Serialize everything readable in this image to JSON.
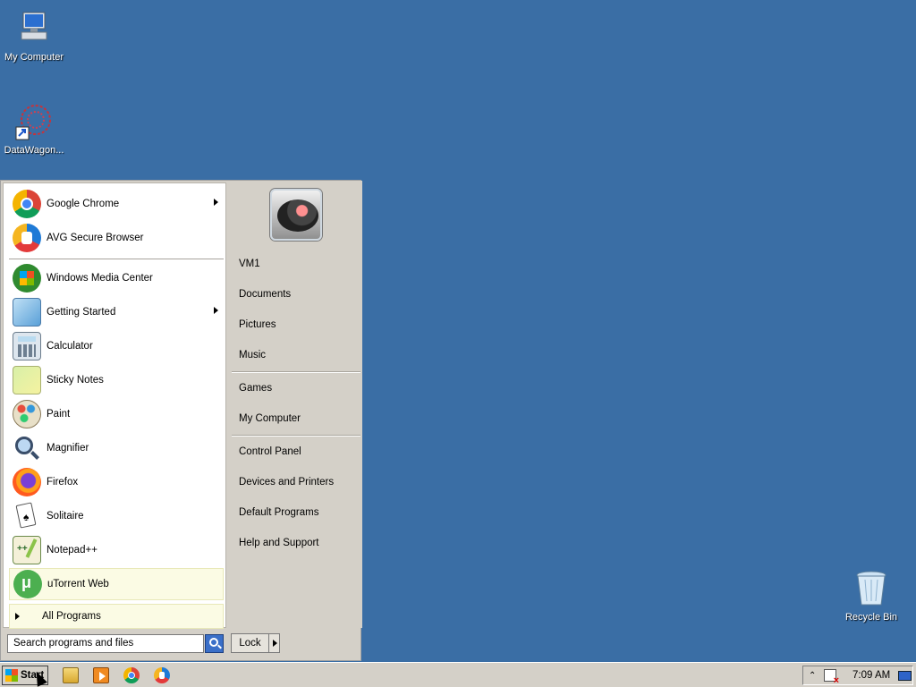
{
  "desktop": {
    "icons": [
      {
        "label": "My Computer"
      },
      {
        "label": "DataWagon..."
      },
      {
        "label": "Recycle Bin"
      }
    ]
  },
  "start_menu": {
    "pinned": [
      {
        "label": "Google Chrome",
        "icon": "chrome-icon",
        "submenu": true
      },
      {
        "label": "AVG Secure Browser",
        "icon": "avg-browser-icon",
        "submenu": false
      }
    ],
    "recent": [
      {
        "label": "Windows Media Center",
        "icon": "media-center-icon",
        "submenu": false
      },
      {
        "label": "Getting Started",
        "icon": "getting-started-icon",
        "submenu": true
      },
      {
        "label": "Calculator",
        "icon": "calculator-icon",
        "submenu": false
      },
      {
        "label": "Sticky Notes",
        "icon": "sticky-notes-icon",
        "submenu": false
      },
      {
        "label": "Paint",
        "icon": "paint-icon",
        "submenu": false
      },
      {
        "label": "Magnifier",
        "icon": "magnifier-icon",
        "submenu": false
      },
      {
        "label": "Firefox",
        "icon": "firefox-icon",
        "submenu": false
      },
      {
        "label": "Solitaire",
        "icon": "solitaire-icon",
        "submenu": false
      },
      {
        "label": "Notepad++",
        "icon": "notepadpp-icon",
        "submenu": false
      },
      {
        "label": "uTorrent Web",
        "icon": "utorrent-icon",
        "submenu": false
      }
    ],
    "all_programs": "All Programs",
    "search_placeholder": "Search programs and files",
    "right": {
      "group1": [
        "VM1",
        "Documents",
        "Pictures",
        "Music"
      ],
      "group2": [
        "Games",
        "My Computer"
      ],
      "group3": [
        "Control Panel",
        "Devices and Printers",
        "Default Programs",
        "Help and Support"
      ]
    },
    "lock_label": "Lock"
  },
  "taskbar": {
    "start_label": "Start",
    "clock": "7:09 AM"
  },
  "colors": {
    "desktop": "#3a6ea5",
    "menu": "#d4d0c8",
    "highlight": "#fbfbe4"
  }
}
